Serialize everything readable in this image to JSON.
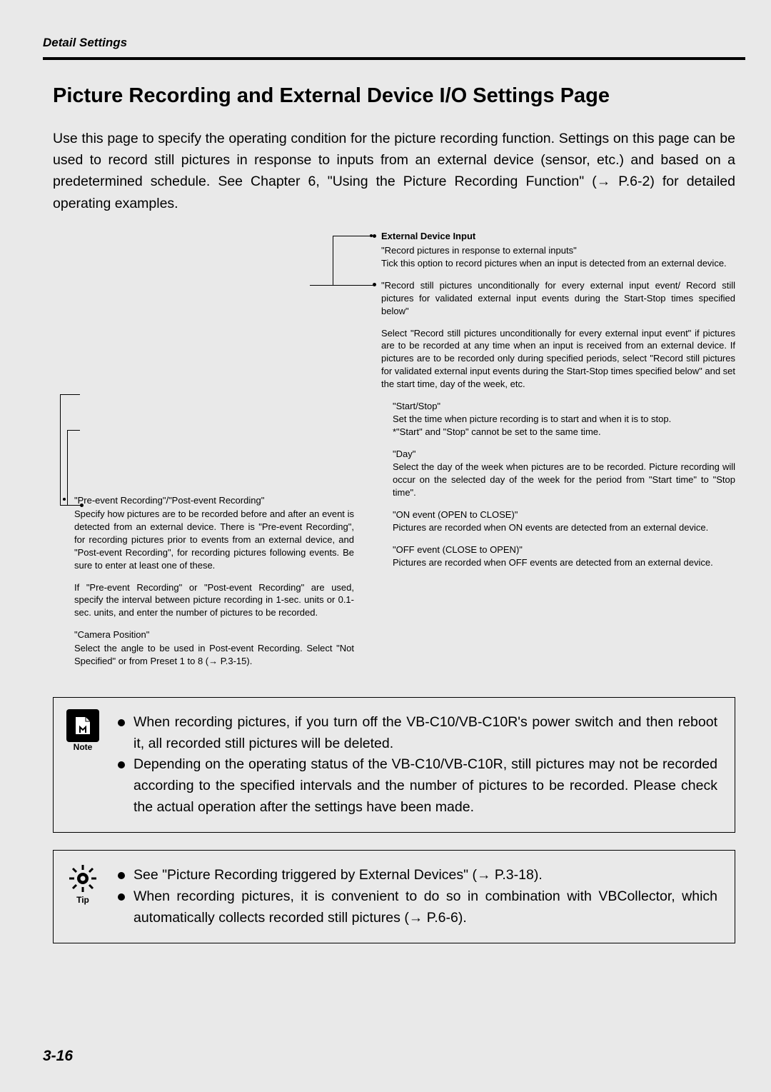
{
  "header": {
    "breadcrumb": "Detail Settings"
  },
  "title": "Picture Recording and External Device I/O Settings Page",
  "intro": "Use this page to specify the operating condition for the picture recording function. Settings on this page can be used to record still pictures in response to inputs from an external device (sensor, etc.) and based on a predetermined schedule. See Chapter 6, \"Using the Picture Recording Function\" (→ P.6-2) for detailed operating examples.",
  "left": {
    "heading": "\"Pre-event Recording\"/\"Post-event Recording\"",
    "p1": "Specify how pictures are to be recorded before and after an event is detected from an external device. There is \"Pre-event Recording\", for recording pictures prior to events from an external device, and \"Post-event Recording\", for recording pictures following events. Be sure to enter at least one of these.",
    "p2": "If \"Pre-event Recording\" or \"Post-event Recording\" are used, specify the interval between picture recording in 1-sec. units or 0.1-sec. units, and enter the number of pictures to be recorded.",
    "camHeading": "\"Camera Position\"",
    "p3": "Select the angle to be used in Post-event Recording. Select \"Not Specified\" or from Preset 1 to 8 (→ P.3-15)."
  },
  "right": {
    "heading": "External Device Input",
    "p1a": "\"Record pictures in response to external inputs\"",
    "p1b": "Tick this option to record pictures when an input is detected from an external device.",
    "p2": "\"Record still pictures unconditionally for every external input event/ Record still pictures for validated external input events during the Start-Stop times specified below\"",
    "p3": "Select \"Record still pictures unconditionally for every external input event\" if pictures are to be recorded at any time when an input is received from an external device. If pictures are to be recorded only during specified periods, select \"Record still pictures for validated external input events during the Start-Stop times specified below\" and set the start time, day of the week, etc.",
    "ssHeading": "\"Start/Stop\"",
    "ssBody": "Set the time when picture recording is to start and when it is to stop.",
    "ssNote": "*\"Start\" and \"Stop\" cannot be set to the same time.",
    "dayHeading": "\"Day\"",
    "dayBody": "Select the day of the week when pictures are to be recorded. Picture recording will occur on the selected day of the week for the period from \"Start time\" to \"Stop time\".",
    "onHeading": "\"ON event (OPEN to CLOSE)\"",
    "onBody": "Pictures are recorded when ON events are detected from an external device.",
    "offHeading": "\"OFF event (CLOSE to OPEN)\"",
    "offBody": "Pictures are recorded when OFF events are detected from an external device."
  },
  "noteBox": {
    "iconLabel": "Note",
    "items": [
      "When recording pictures, if you turn off the VB-C10/VB-C10R's power switch and then reboot it, all recorded still pictures will be deleted.",
      "Depending on the operating status of the VB-C10/VB-C10R, still pictures may not be recorded according to the specified intervals and the number of pictures to be recorded. Please check the actual operation after the settings have been made."
    ]
  },
  "tipBox": {
    "iconLabel": "Tip",
    "items": [
      "See \"Picture Recording triggered by External Devices\" (→ P.3-18).",
      "When recording pictures, it is convenient to do so in combination with VBCollector, which automatically collects recorded still pictures (→ P.6-6)."
    ]
  },
  "pageNumber": "3-16"
}
